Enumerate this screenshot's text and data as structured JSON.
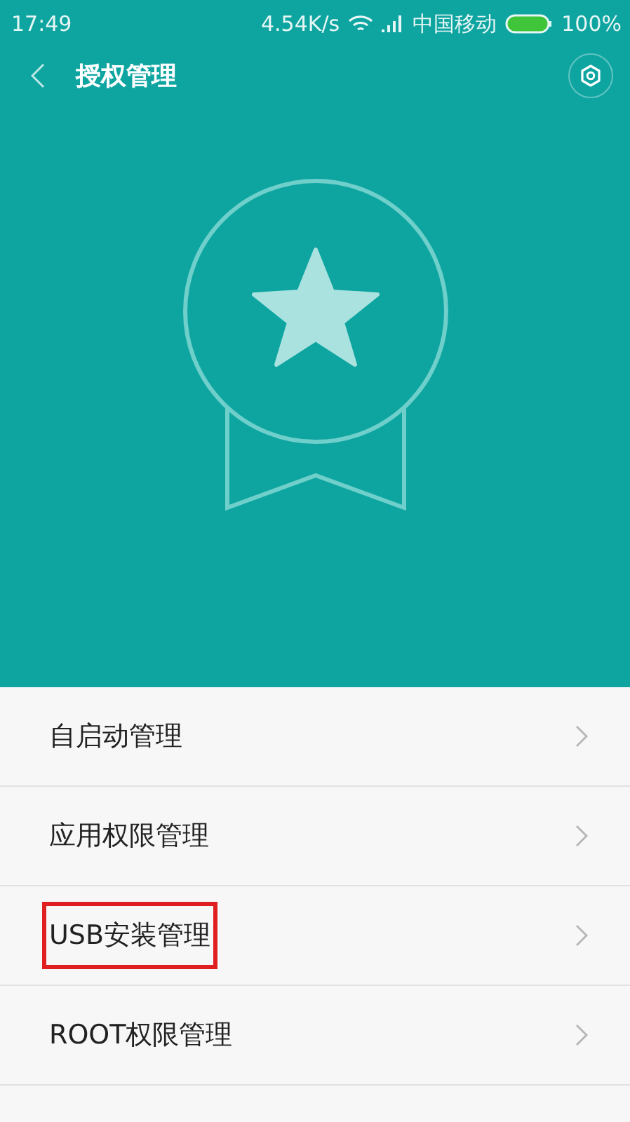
{
  "status_bar": {
    "time": "17:49",
    "speed": "4.54K/s",
    "carrier": "中国移动",
    "battery": "100%"
  },
  "header": {
    "title": "授权管理"
  },
  "menu": [
    {
      "label": "自启动管理",
      "highlighted": false
    },
    {
      "label": "应用权限管理",
      "highlighted": false
    },
    {
      "label": "USB安装管理",
      "highlighted": true
    },
    {
      "label": "ROOT权限管理",
      "highlighted": false
    }
  ]
}
